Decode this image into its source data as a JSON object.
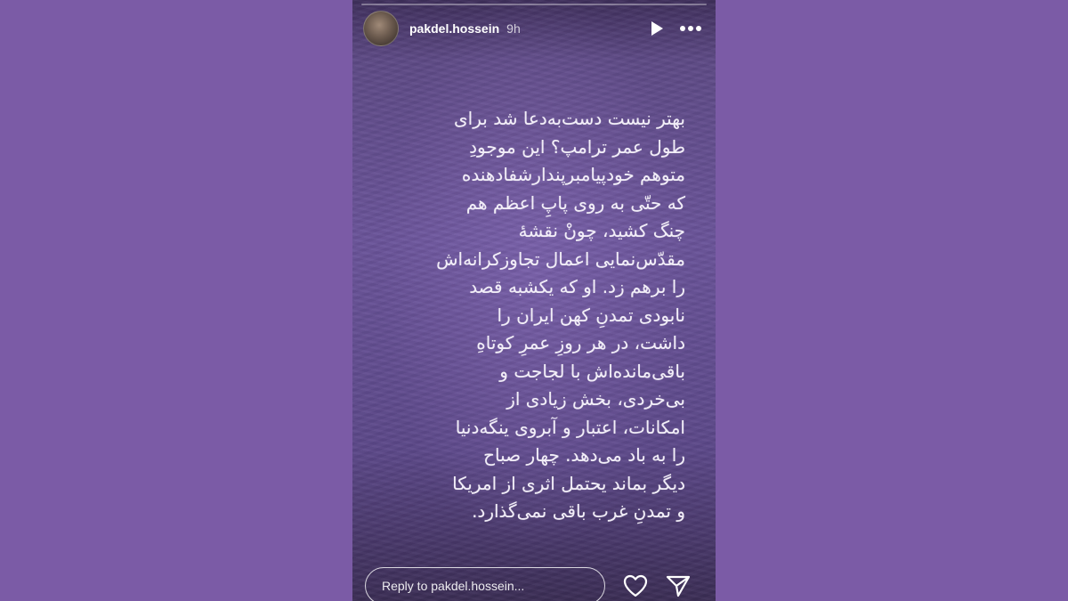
{
  "header": {
    "username": "pakdel.hossein",
    "time": "9h"
  },
  "story": {
    "lines": [
      "بهتر نیست دست‌به‌دعا شد برای",
      "طول عمر ترامپ؟ این موجودِ",
      "متوهم خودپیامبرپندارشفادهنده",
      "که حتّی به روی پاپِ اعظم هم",
      "چنگ کشید، چونْ نقشهٔ",
      "مقدّس‌نمایی اعمال تجاوزکرانه‌اش",
      "را برهم زد. او که یکشبه قصد",
      "نابودی تمدنِ کهن ایران را",
      "داشت، در هر روزِ عمرِ کوتاهِ",
      "باقی‌مانده‌اش با لجاجت و",
      "بی‌خردی، بخش زیادی از",
      "امکانات، اعتبار و آبروی ینگه‌دنیا",
      "را به باد می‌دهد. چهار صباح",
      "دیگر بماند یحتمل اثری از امریکا",
      "و تمدنِ غرب باقی نمی‌گذارد."
    ]
  },
  "footer": {
    "reply_placeholder": "Reply to pakdel.hossein..."
  },
  "icons": {
    "play": "play-icon",
    "more": "more-icon",
    "like": "heart-icon",
    "share": "send-icon"
  },
  "colors": {
    "page_background": "#7b5ba6",
    "story_background": "#6a549a",
    "text": "#f2eef8"
  }
}
